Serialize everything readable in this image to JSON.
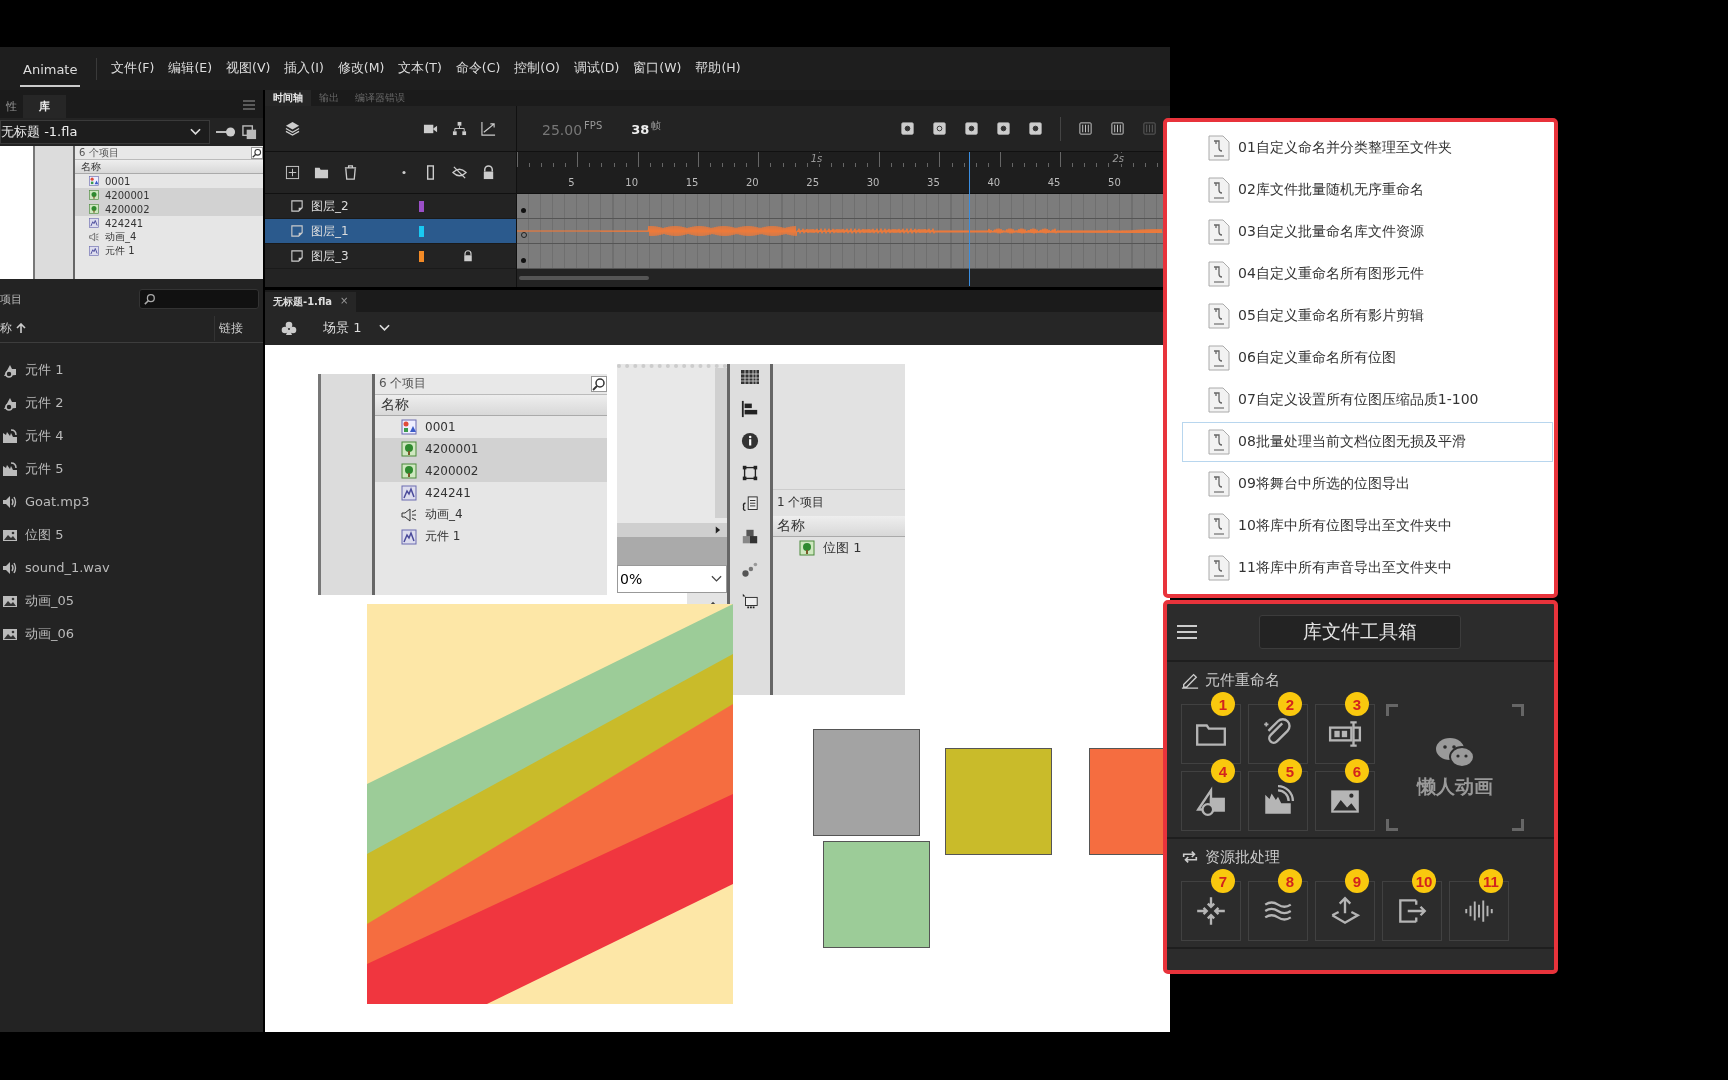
{
  "menu_bar": {
    "app": "Animate",
    "items": [
      "文件(F)",
      "编辑(E)",
      "视图(V)",
      "插入(I)",
      "修改(M)",
      "文本(T)",
      "命令(C)",
      "控制(O)",
      "调试(D)",
      "窗口(W)",
      "帮助(H)"
    ]
  },
  "library_panel": {
    "tabs": [
      {
        "label": "性",
        "selected": false
      },
      {
        "label": "库",
        "selected": true
      }
    ],
    "document": "无标题 -1.fla",
    "preview": {
      "count": "6 个项目",
      "column": "名称",
      "items": [
        {
          "kind": "multi",
          "name": "0001",
          "selected": false
        },
        {
          "kind": "bitmap",
          "name": "4200001",
          "selected": true
        },
        {
          "kind": "bitmap",
          "name": "4200002",
          "selected": true
        },
        {
          "kind": "movieclip",
          "name": "424241",
          "selected": false
        },
        {
          "kind": "sound",
          "name": "动画_4",
          "selected": false
        },
        {
          "kind": "movieclip",
          "name": "元件 1",
          "selected": false
        }
      ]
    },
    "count": "项目",
    "columns": [
      "称",
      "链接"
    ],
    "items": [
      {
        "kind": "graphic",
        "name": "元件 1"
      },
      {
        "kind": "graphic",
        "name": "元件 2"
      },
      {
        "kind": "movieclip",
        "name": "元件 4"
      },
      {
        "kind": "movieclip",
        "name": "元件 5"
      },
      {
        "kind": "sound",
        "name": "Goat.mp3"
      },
      {
        "kind": "bitmap",
        "name": "位图 5"
      },
      {
        "kind": "sound",
        "name": "sound_1.wav"
      },
      {
        "kind": "bitmap",
        "name": "动画_05"
      },
      {
        "kind": "bitmap",
        "name": "动画_06"
      }
    ]
  },
  "timeline": {
    "tabs": [
      {
        "label": "时间轴",
        "selected": true
      },
      {
        "label": "输出",
        "selected": false
      },
      {
        "label": "编译器错误",
        "selected": false
      }
    ],
    "fps": "25.00",
    "fps_unit": "FPS",
    "frame": "38",
    "frame_unit": "帧",
    "seconds": [
      "1s",
      "2s"
    ],
    "frame_numbers": [
      "5",
      "10",
      "15",
      "20",
      "25",
      "30",
      "35",
      "40",
      "45",
      "50"
    ],
    "layers": [
      {
        "name": "图层_2",
        "color": "#9b4fc8",
        "selected": false,
        "locked": false,
        "kind": "keyframe"
      },
      {
        "name": "图层_1",
        "color": "#19c9f2",
        "selected": true,
        "locked": false,
        "kind": "sound"
      },
      {
        "name": "图层_3",
        "color": "#f28a26",
        "selected": false,
        "locked": true,
        "kind": "keyframe"
      }
    ]
  },
  "document_tab": {
    "title": "无标题-1.fla",
    "close": "×"
  },
  "scene": {
    "label": "场景 1"
  },
  "stage": {
    "library_shot": {
      "count": "6 个项目",
      "column": "名称",
      "items": [
        {
          "kind": "multi",
          "name": "0001",
          "selected": false
        },
        {
          "kind": "bitmap",
          "name": "4200001",
          "selected": true
        },
        {
          "kind": "bitmap",
          "name": "4200002",
          "selected": true
        },
        {
          "kind": "movieclip",
          "name": "424241",
          "selected": false
        },
        {
          "kind": "sound",
          "name": "动画_4",
          "selected": false
        },
        {
          "kind": "movieclip",
          "name": "元件 1",
          "selected": false
        }
      ]
    },
    "panel_shot": {
      "zoom": "0%",
      "count": "1 个项目",
      "column": "名称",
      "items": [
        {
          "kind": "bitmap",
          "name": "位图 1"
        }
      ]
    },
    "shapes": [
      {
        "color": "#a3a3a3"
      },
      {
        "color": "#c9bb2a"
      },
      {
        "color": "#f56d40"
      },
      {
        "color": "#9ccc98"
      }
    ]
  },
  "script_list": {
    "items": [
      {
        "label": "01自定义命名并分类整理至文件夹",
        "selected": false
      },
      {
        "label": "02库文件批量随机无序重命名",
        "selected": false
      },
      {
        "label": "03自定义批量命名库文件资源",
        "selected": false
      },
      {
        "label": "04自定义重命名所有图形元件",
        "selected": false
      },
      {
        "label": "05自定义重命名所有影片剪辑",
        "selected": false
      },
      {
        "label": "06自定义重命名所有位图",
        "selected": false
      },
      {
        "label": "07自定义设置所有位图压缩品质1-100",
        "selected": false
      },
      {
        "label": "08批量处理当前文档位图无损及平滑",
        "selected": true
      },
      {
        "label": "09将舞台中所选的位图导出",
        "selected": false
      },
      {
        "label": "10将库中所有位图导出至文件夹中",
        "selected": false
      },
      {
        "label": "11将库中所有声音导出至文件夹中",
        "selected": false
      }
    ]
  },
  "toolbox": {
    "title": "库文件工具箱",
    "logo": "懒人动画",
    "sections": [
      {
        "title": "元件重命名",
        "buttons": [
          {
            "badge": "1",
            "kind": "folder"
          },
          {
            "badge": "2",
            "kind": "clip"
          },
          {
            "badge": "3",
            "kind": "textbox"
          },
          {
            "badge": "4",
            "kind": "shapes"
          },
          {
            "badge": "5",
            "kind": "movieclip"
          },
          {
            "badge": "6",
            "kind": "image"
          }
        ]
      },
      {
        "title": "资源批处理",
        "buttons": [
          {
            "badge": "7",
            "kind": "compress"
          },
          {
            "badge": "8",
            "kind": "waves"
          },
          {
            "badge": "9",
            "kind": "upload"
          },
          {
            "badge": "10",
            "kind": "export"
          },
          {
            "badge": "11",
            "kind": "audio"
          }
        ]
      }
    ]
  }
}
